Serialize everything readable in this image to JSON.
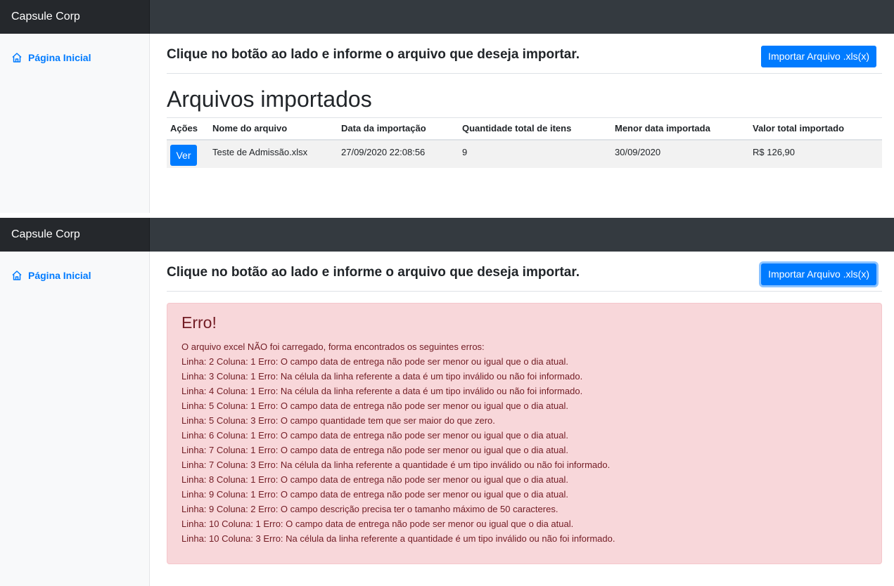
{
  "app": {
    "brand": "Capsule Corp"
  },
  "sidebar": {
    "home_label": "Página Inicial"
  },
  "header": {
    "instruction": "Clique no botão ao lado e informe o arquivo que deseja importar.",
    "import_button": "Importar Arquivo .xls(x)"
  },
  "imports": {
    "title": "Arquivos importados",
    "columns": [
      "Ações",
      "Nome do arquivo",
      "Data da importação",
      "Quantidade total de itens",
      "Menor data importada",
      "Valor total importado"
    ],
    "rows": [
      {
        "action": "Ver",
        "file_name": "Teste de Admissão.xlsx",
        "import_date": "27/09/2020 22:08:56",
        "total_items": "9",
        "min_date": "30/09/2020",
        "total_value": "R$ 126,90"
      }
    ]
  },
  "error": {
    "title": "Erro!",
    "intro": "O arquivo excel NÃO foi carregado, forma encontrados os seguintes erros:",
    "lines": [
      "Linha: 2 Coluna: 1 Erro: O campo data de entrega não pode ser menor ou igual que o dia atual.",
      "Linha: 3 Coluna: 1 Erro: Na célula da linha referente a data é um tipo inválido ou não foi informado.",
      "Linha: 4 Coluna: 1 Erro: Na célula da linha referente a data é um tipo inválido ou não foi informado.",
      "Linha: 5 Coluna: 1 Erro: O campo data de entrega não pode ser menor ou igual que o dia atual.",
      "Linha: 5 Coluna: 3 Erro: O campo quantidade tem que ser maior do que zero.",
      "Linha: 6 Coluna: 1 Erro: O campo data de entrega não pode ser menor ou igual que o dia atual.",
      "Linha: 7 Coluna: 1 Erro: O campo data de entrega não pode ser menor ou igual que o dia atual.",
      "Linha: 7 Coluna: 3 Erro: Na célula da linha referente a quantidade é um tipo inválido ou não foi informado.",
      "Linha: 8 Coluna: 1 Erro: O campo data de entrega não pode ser menor ou igual que o dia atual.",
      "Linha: 9 Coluna: 1 Erro: O campo data de entrega não pode ser menor ou igual que o dia atual.",
      "Linha: 9 Coluna: 2 Erro: O campo descrição precisa ter o tamanho máximo de 50 caracteres.",
      "Linha: 10 Coluna: 1 Erro: O campo data de entrega não pode ser menor ou igual que o dia atual.",
      "Linha: 10 Coluna: 3 Erro: Na célula da linha referente a quantidade é um tipo inválido ou não foi informado."
    ]
  },
  "colors": {
    "navbar": "#343a40",
    "brand_bg": "#25282c",
    "primary": "#007bff",
    "danger_bg": "#f8d7da",
    "danger_text": "#721c24"
  }
}
